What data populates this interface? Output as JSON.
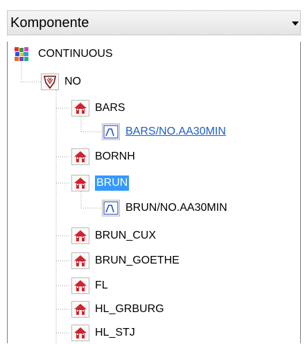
{
  "combo": {
    "value": "Komponente",
    "icon": "chevron-down-icon"
  },
  "tree": {
    "root": {
      "label": "CONTINUOUS",
      "icon": "continuous-icon"
    },
    "group": {
      "label": "NO",
      "icon": "shield-icon"
    },
    "stations": [
      {
        "label": "BARS",
        "icon": "station-icon",
        "children": [
          {
            "label": "BARS/NO.AA30MIN",
            "icon": "series-icon",
            "style": "link"
          }
        ]
      },
      {
        "label": "BORNH",
        "icon": "station-icon"
      },
      {
        "label": "BRUN",
        "icon": "station-icon",
        "selected": true,
        "children": [
          {
            "label": "BRUN/NO.AA30MIN",
            "icon": "series-icon"
          }
        ]
      },
      {
        "label": "BRUN_CUX",
        "icon": "station-icon"
      },
      {
        "label": "BRUN_GOETHE",
        "icon": "station-icon"
      },
      {
        "label": "FL",
        "icon": "station-icon"
      },
      {
        "label": "HL_GRBURG",
        "icon": "station-icon"
      },
      {
        "label": "HL_STJ",
        "icon": "station-icon"
      }
    ]
  },
  "colors": {
    "selection": "#3399ff",
    "link": "#1a5fc8",
    "station_red": "#d3242d"
  }
}
